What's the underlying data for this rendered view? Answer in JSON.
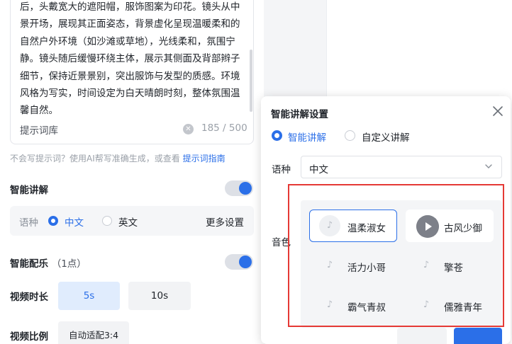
{
  "prompt": {
    "text": "后，头戴宽大的遮阳帽，服饰图案为印花。镜头从中景开场，展现其正面姿态，背景虚化呈现温暖柔和的自然户外环境（如沙滩或草地），光线柔和，氛围宁静。镜头随后缓慢环绕主体，展示其侧面及背部辫子细节，保持近景景别，突出服饰与发型的质感。环境风格为写实，时间设定为白天晴朗时刻，整体氛围温馨自然。",
    "library_label": "提示词库",
    "char_count": "185 / 500"
  },
  "hint": {
    "text": "不会写提示词？使用AI帮写准确生成，或查看 ",
    "link": "提示词指南"
  },
  "narration": {
    "label": "智能讲解",
    "enabled": true,
    "language_label": "语种",
    "options": [
      "中文",
      "英文"
    ],
    "selected": "中文",
    "more_settings": "更多设置"
  },
  "music": {
    "label": "智能配乐",
    "cost": "（1点）",
    "enabled": true
  },
  "duration": {
    "label": "视频时长",
    "options": [
      "5s",
      "10s"
    ],
    "selected": "5s"
  },
  "ratio": {
    "label": "视频比例",
    "value": "自动适配3:4"
  },
  "popup": {
    "title": "智能讲解设置",
    "modes": [
      "智能讲解",
      "自定义讲解"
    ],
    "selected_mode": "智能讲解",
    "language_label": "语种",
    "language_value": "中文",
    "voice_label": "音色",
    "voices": [
      {
        "name": "温柔淑女",
        "state": "selected"
      },
      {
        "name": "古风少御",
        "state": "playing"
      },
      {
        "name": "活力小哥",
        "state": "normal"
      },
      {
        "name": "擎苍",
        "state": "normal"
      },
      {
        "name": "霸气青叔",
        "state": "normal"
      },
      {
        "name": "儒雅青年",
        "state": "normal"
      }
    ]
  },
  "colors": {
    "accent": "#2b6fe8",
    "highlight_frame": "#e53935"
  }
}
